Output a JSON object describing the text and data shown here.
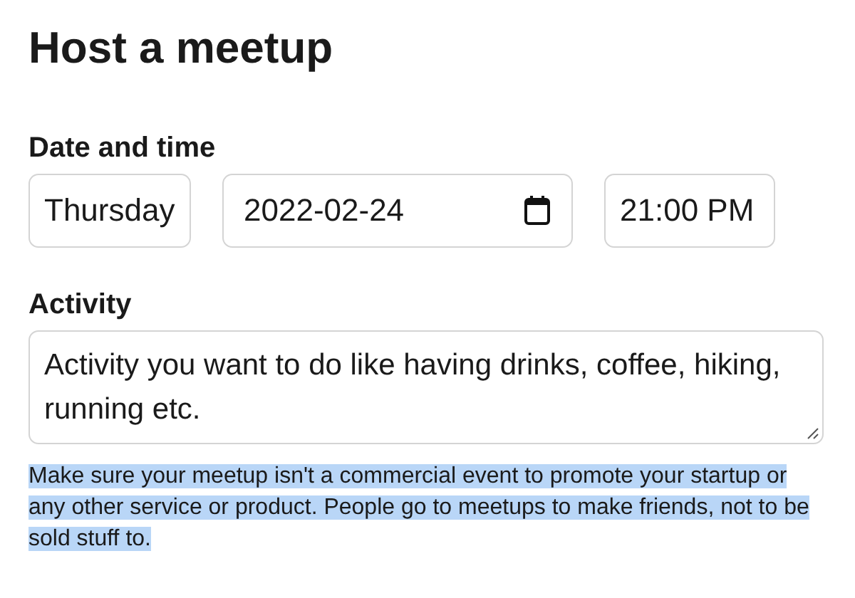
{
  "title": "Host a meetup",
  "date_time": {
    "label": "Date and time",
    "day": {
      "value": "Thursday"
    },
    "date": {
      "value": "2022-02-24"
    },
    "time": {
      "value": "21:00 PM"
    }
  },
  "activity": {
    "label": "Activity",
    "value": "Activity you want to do like having drinks, coffee, hiking, running etc."
  },
  "note": {
    "text": "Make sure your meetup isn't a commercial event to promote your startup or any other service or product. People go to meetups to make friends, not to be sold stuff to.",
    "highlighted": true
  }
}
